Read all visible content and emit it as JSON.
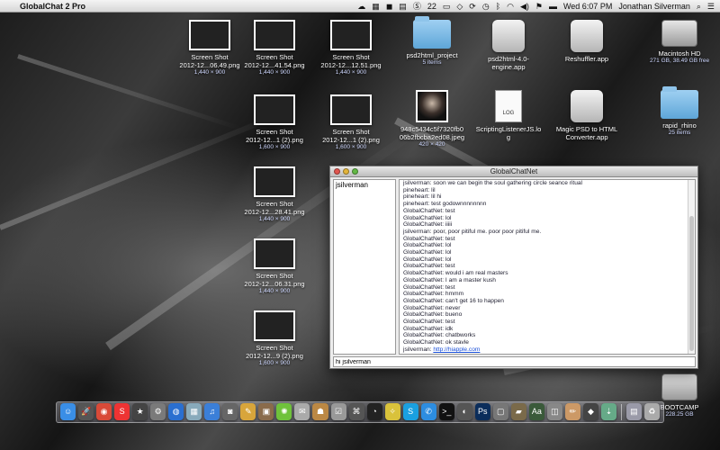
{
  "menubar": {
    "app_name": "GlobalChat 2 Pro",
    "menus": [],
    "status": {
      "badge": "22",
      "clock": "Wed 6:07 PM",
      "user": "Jonathan Silverman"
    }
  },
  "desktop": {
    "icons": [
      {
        "label": "Screen Shot",
        "label2": "2012-12...06.49.png",
        "sub": "1,440 × 900",
        "kind": "shot"
      },
      {
        "label": "Screen Shot",
        "label2": "2012-12...41.54.png",
        "sub": "1,440 × 900",
        "kind": "shot"
      },
      {
        "label": "Screen Shot",
        "label2": "2012-12...12.51.png",
        "sub": "1,440 × 900",
        "kind": "shot"
      },
      {
        "label": "psd2html_project",
        "label2": "",
        "sub": "5 items",
        "kind": "folder"
      },
      {
        "label": "psd2html-4.0-",
        "label2": "engine.app",
        "sub": "",
        "kind": "app"
      },
      {
        "label": "Reshuffler.app",
        "label2": "",
        "sub": "",
        "kind": "app"
      },
      {
        "label": "Macintosh HD",
        "label2": "",
        "sub": "271 GB, 38.49 GB free",
        "kind": "hdd"
      },
      {
        "label": "Screen Shot",
        "label2": "2012-12...1 (2).png",
        "sub": "1,600 × 900",
        "kind": "shot"
      },
      {
        "label": "Screen Shot",
        "label2": "2012-12...1 (2).png",
        "sub": "1,600 × 900",
        "kind": "shot"
      },
      {
        "label": "948c5434c5f7320fb0",
        "label2": "06b2fbcba2ed08.jpeg",
        "sub": "420 × 420",
        "kind": "photo"
      },
      {
        "label": "ScriptingListenerJS.lo",
        "label2": "g",
        "sub": "",
        "kind": "doc"
      },
      {
        "label": "Magic PSD to HTML",
        "label2": "Converter.app",
        "sub": "",
        "kind": "app"
      },
      {
        "label": "rapid_rhino",
        "label2": "",
        "sub": "25 items",
        "kind": "folder"
      },
      {
        "label": "Screen Shot",
        "label2": "2012-12...28.41.png",
        "sub": "1,440 × 900",
        "kind": "shot"
      },
      {
        "label": "Screen Shot",
        "label2": "2012-12...06.31.png",
        "sub": "1,440 × 900",
        "kind": "shot"
      },
      {
        "label": "Screen Shot",
        "label2": "2012-12...9 (2).png",
        "sub": "1,600 × 900",
        "kind": "shot"
      },
      {
        "label": "BOOTCAMP",
        "label2": "",
        "sub": "228.25 GB",
        "kind": "hdd"
      }
    ],
    "doc_badge": "LOG"
  },
  "chat_window": {
    "title": "GlobalChatNet",
    "users": [
      "jsilverman"
    ],
    "messages": [
      "jsilverman: soon we can begin the soul gathering circle seance ritual",
      "pineheart: lil",
      "pineheart: lil hi",
      "pineheart: test godownnnnnnnn",
      "GlobalChatNet: test",
      "GlobalChatNet: lol",
      "GlobalChatNet: iiiii",
      "jsilverman: poor, poor pitiful me. poor poor pitiful me.",
      "GlobalChatNet: test",
      "GlobalChatNet: lol",
      "GlobalChatNet: lol",
      "GlobalChatNet: lol",
      "GlobalChatNet: test",
      "GlobalChatNet: would i am real masters",
      "GlobalChatNet: I am a master kush",
      "GlobalChatNet: test",
      "GlobalChatNet: hmmm",
      "GlobalChatNet: can't get 16 to happen",
      "GlobalChatNet: never",
      "GlobalChatNet: bueno",
      "GlobalChatNet: test",
      "GlobalChatNet: idk",
      "GlobalChatNet: chatbworks",
      "GlobalChatNet: ok stavle"
    ],
    "last_message_prefix": "jsilverman: ",
    "last_message_link": "http://hiapple.com",
    "input_value": "hi jsilverman"
  },
  "dock": {
    "icons": [
      {
        "name": "finder-icon",
        "glyph": "☺",
        "color": "#3a8ee6"
      },
      {
        "name": "launchpad-icon",
        "glyph": "🚀",
        "color": "#555"
      },
      {
        "name": "chrome-icon",
        "glyph": "◉",
        "color": "#d94a38"
      },
      {
        "name": "slides-icon",
        "glyph": "S",
        "color": "#e33"
      },
      {
        "name": "star-icon",
        "glyph": "★",
        "color": "#444"
      },
      {
        "name": "settings-icon",
        "glyph": "⚙",
        "color": "#7a7a7a"
      },
      {
        "name": "globe-icon",
        "glyph": "◍",
        "color": "#2a6fd0"
      },
      {
        "name": "calendar-icon",
        "glyph": "▦",
        "color": "#8ab"
      },
      {
        "name": "music-icon",
        "glyph": "♫",
        "color": "#3b7fd8"
      },
      {
        "name": "camera-icon",
        "glyph": "◙",
        "color": "#666"
      },
      {
        "name": "notes-icon",
        "glyph": "✎",
        "color": "#d8a53b"
      },
      {
        "name": "photo-icon",
        "glyph": "▣",
        "color": "#8a6b4b"
      },
      {
        "name": "lime-icon",
        "glyph": "✺",
        "color": "#6fc23b"
      },
      {
        "name": "mail-icon",
        "glyph": "✉",
        "color": "#aaa"
      },
      {
        "name": "contacts-icon",
        "glyph": "☗",
        "color": "#b84"
      },
      {
        "name": "checklist-icon",
        "glyph": "☑",
        "color": "#999"
      },
      {
        "name": "system-icon",
        "glyph": "⌘",
        "color": "#555"
      },
      {
        "name": "clock-icon",
        "glyph": "◔",
        "color": "#222"
      },
      {
        "name": "bulb-icon",
        "glyph": "✧",
        "color": "#d9c23b"
      },
      {
        "name": "skype-icon",
        "glyph": "S",
        "color": "#1aa0e0"
      },
      {
        "name": "chat-icon",
        "glyph": "✆",
        "color": "#2d8de0"
      },
      {
        "name": "terminal-icon",
        "glyph": ">_",
        "color": "#111"
      },
      {
        "name": "spy-icon",
        "glyph": "◐",
        "color": "#555"
      },
      {
        "name": "photoshop-icon",
        "glyph": "Ps",
        "color": "#0b2d5b"
      },
      {
        "name": "window-icon",
        "glyph": "▢",
        "color": "#777"
      },
      {
        "name": "folder-icon",
        "glyph": "▰",
        "color": "#7a6a4a"
      },
      {
        "name": "dictionary-icon",
        "glyph": "Aa",
        "color": "#3a5a3a"
      },
      {
        "name": "preview-icon",
        "glyph": "◫",
        "color": "#888"
      },
      {
        "name": "pencil-icon",
        "glyph": "✏",
        "color": "#c96"
      },
      {
        "name": "app2-icon",
        "glyph": "◆",
        "color": "#444"
      },
      {
        "name": "downloads-icon",
        "glyph": "⇣",
        "color": "#6a8"
      },
      {
        "name": "docs-icon",
        "glyph": "▤",
        "color": "#9a9aa8"
      },
      {
        "name": "trash-icon",
        "glyph": "♻",
        "color": "#aaa"
      }
    ]
  }
}
